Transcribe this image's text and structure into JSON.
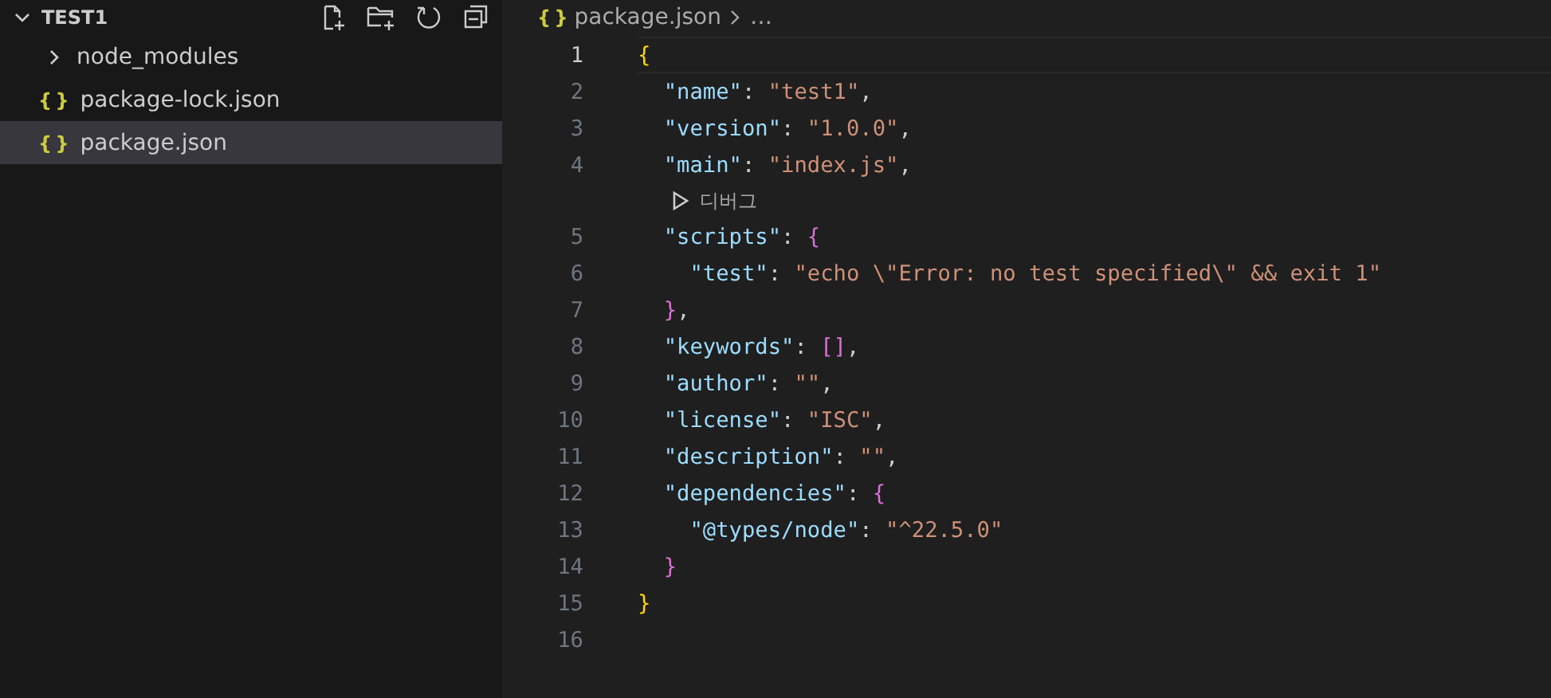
{
  "explorer": {
    "title": "TEST1",
    "expanded": true,
    "items": [
      {
        "kind": "folder",
        "label": "node_modules",
        "expanded": false,
        "selected": false
      },
      {
        "kind": "file",
        "icon": "{ }",
        "label": "package-lock.json",
        "selected": false
      },
      {
        "kind": "file",
        "icon": "{ }",
        "label": "package.json",
        "selected": true
      }
    ]
  },
  "breadcrumb": {
    "icon": "{ }",
    "file": "package.json",
    "more": "…"
  },
  "lines": [
    {
      "kind": "code",
      "number": "1",
      "current": true,
      "tokens": [
        {
          "kind": "brace1",
          "text": "{"
        }
      ]
    },
    {
      "kind": "code",
      "number": "2",
      "current": false,
      "tokens": [
        {
          "kind": "key",
          "text": "  \"name\""
        },
        {
          "kind": "punct",
          "text": ": "
        },
        {
          "kind": "string",
          "text": "\"test1\""
        },
        {
          "kind": "punct",
          "text": ","
        }
      ]
    },
    {
      "kind": "code",
      "number": "3",
      "current": false,
      "tokens": [
        {
          "kind": "key",
          "text": "  \"version\""
        },
        {
          "kind": "punct",
          "text": ": "
        },
        {
          "kind": "string",
          "text": "\"1.0.0\""
        },
        {
          "kind": "punct",
          "text": ","
        }
      ]
    },
    {
      "kind": "code",
      "number": "4",
      "current": false,
      "tokens": [
        {
          "kind": "key",
          "text": "  \"main\""
        },
        {
          "kind": "punct",
          "text": ": "
        },
        {
          "kind": "string",
          "text": "\"index.js\""
        },
        {
          "kind": "punct",
          "text": ","
        }
      ]
    },
    {
      "kind": "codelens",
      "label": "디버그"
    },
    {
      "kind": "code",
      "number": "5",
      "current": false,
      "tokens": [
        {
          "kind": "key",
          "text": "  \"scripts\""
        },
        {
          "kind": "punct",
          "text": ": "
        },
        {
          "kind": "brace2",
          "text": "{"
        }
      ]
    },
    {
      "kind": "code",
      "number": "6",
      "current": false,
      "tokens": [
        {
          "kind": "key",
          "text": "    \"test\""
        },
        {
          "kind": "punct",
          "text": ": "
        },
        {
          "kind": "string",
          "text": "\"echo \\\"Error: no test specified\\\" && exit 1\""
        }
      ]
    },
    {
      "kind": "code",
      "number": "7",
      "current": false,
      "tokens": [
        {
          "kind": "brace2",
          "text": "  }"
        },
        {
          "kind": "punct",
          "text": ","
        }
      ]
    },
    {
      "kind": "code",
      "number": "8",
      "current": false,
      "tokens": [
        {
          "kind": "key",
          "text": "  \"keywords\""
        },
        {
          "kind": "punct",
          "text": ": "
        },
        {
          "kind": "brace2",
          "text": "[]"
        },
        {
          "kind": "punct",
          "text": ","
        }
      ]
    },
    {
      "kind": "code",
      "number": "9",
      "current": false,
      "tokens": [
        {
          "kind": "key",
          "text": "  \"author\""
        },
        {
          "kind": "punct",
          "text": ": "
        },
        {
          "kind": "string",
          "text": "\"\""
        },
        {
          "kind": "punct",
          "text": ","
        }
      ]
    },
    {
      "kind": "code",
      "number": "10",
      "current": false,
      "tokens": [
        {
          "kind": "key",
          "text": "  \"license\""
        },
        {
          "kind": "punct",
          "text": ": "
        },
        {
          "kind": "string",
          "text": "\"ISC\""
        },
        {
          "kind": "punct",
          "text": ","
        }
      ]
    },
    {
      "kind": "code",
      "number": "11",
      "current": false,
      "tokens": [
        {
          "kind": "key",
          "text": "  \"description\""
        },
        {
          "kind": "punct",
          "text": ": "
        },
        {
          "kind": "string",
          "text": "\"\""
        },
        {
          "kind": "punct",
          "text": ","
        }
      ]
    },
    {
      "kind": "code",
      "number": "12",
      "current": false,
      "tokens": [
        {
          "kind": "key",
          "text": "  \"dependencies\""
        },
        {
          "kind": "punct",
          "text": ": "
        },
        {
          "kind": "brace2",
          "text": "{"
        }
      ]
    },
    {
      "kind": "code",
      "number": "13",
      "current": false,
      "tokens": [
        {
          "kind": "key",
          "text": "    \"@types/node\""
        },
        {
          "kind": "punct",
          "text": ": "
        },
        {
          "kind": "string",
          "text": "\"^22.5.0\""
        }
      ]
    },
    {
      "kind": "code",
      "number": "14",
      "current": false,
      "tokens": [
        {
          "kind": "brace2",
          "text": "  }"
        }
      ]
    },
    {
      "kind": "code",
      "number": "15",
      "current": false,
      "tokens": [
        {
          "kind": "brace1",
          "text": "}"
        }
      ]
    },
    {
      "kind": "code",
      "number": "16",
      "current": false
    }
  ]
}
